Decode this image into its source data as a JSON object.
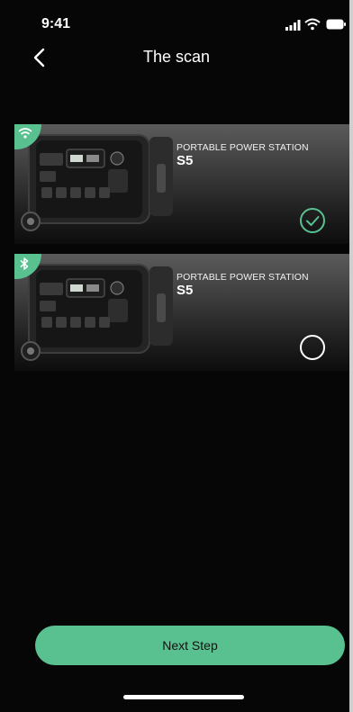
{
  "status_bar": {
    "time": "9:41",
    "icons": [
      "signal-icon",
      "wifi-icon",
      "battery-icon"
    ]
  },
  "nav": {
    "title": "The scan",
    "back_icon": "chevron-left-icon"
  },
  "devices": [
    {
      "type_label": "PORTABLE POWER STATION",
      "name": "S5",
      "connection": "wifi-icon",
      "selected": true
    },
    {
      "type_label": "PORTABLE POWER STATION",
      "name": "S5",
      "connection": "bluetooth-icon",
      "selected": false
    }
  ],
  "next_button": {
    "label": "Next Step"
  },
  "colors": {
    "accent": "#59c18f",
    "background": "#060606"
  }
}
